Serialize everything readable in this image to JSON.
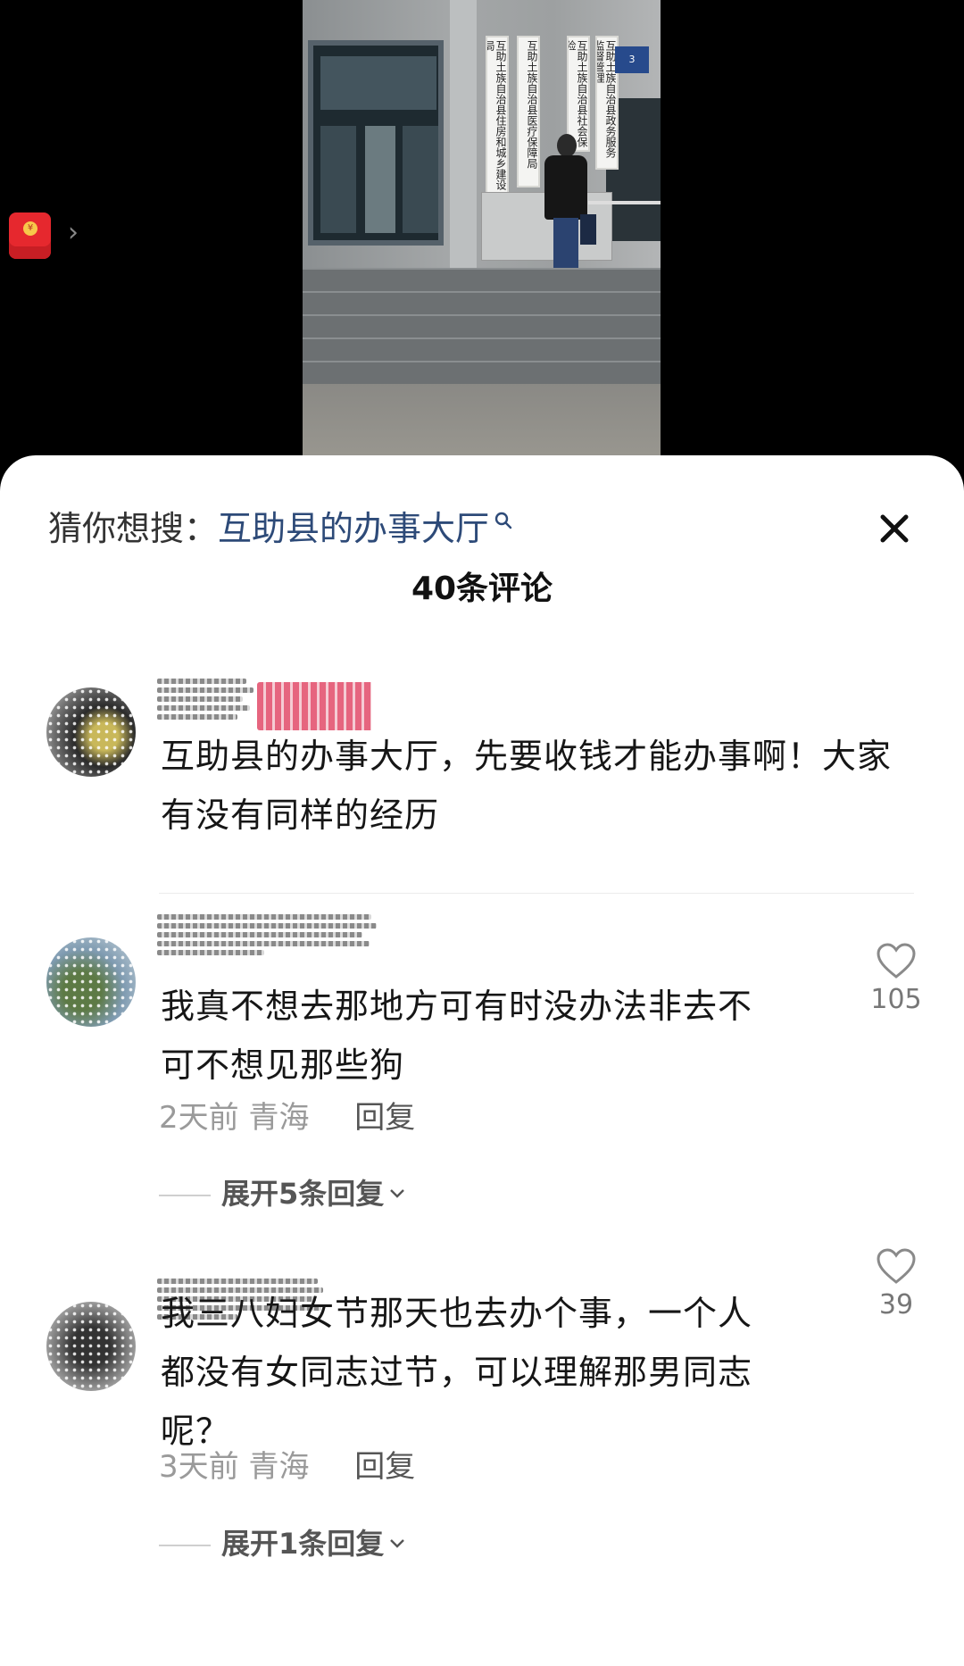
{
  "video": {
    "signs": [
      "互助土族自治县住房和城乡建设局",
      "互助土族自治县医疗保障局",
      "互助土族自治县社会保险",
      "互助土族自治县政务服务监督管理"
    ],
    "plate_number": "3",
    "redpack_icon": "red-envelope-icon"
  },
  "search": {
    "label": "猜你想搜：",
    "query": "互助县的办事大厅"
  },
  "comments_header": {
    "title": "40条评论"
  },
  "comments": [
    {
      "text": "互助县的办事大厅，先要收钱才能办事啊！大家有没有同样的经历"
    },
    {
      "text": "我真不想去那地方可有时没办法非去不可不想见那些狗",
      "likes": "105",
      "time": "2天前",
      "location": "青海",
      "reply_label": "回复",
      "expand_label": "展开5条回复"
    },
    {
      "text": "我三八妇女节那天也去办个事，一个人都没有女同志过节，可以理解那男同志呢？",
      "likes": "39",
      "time": "3天前",
      "location": "青海",
      "reply_label": "回复",
      "expand_label": "展开1条回复"
    }
  ],
  "colors": {
    "query_blue": "#2d4a78",
    "meta_gray": "#9a9a9a",
    "red_envelope": "#e6282e"
  }
}
